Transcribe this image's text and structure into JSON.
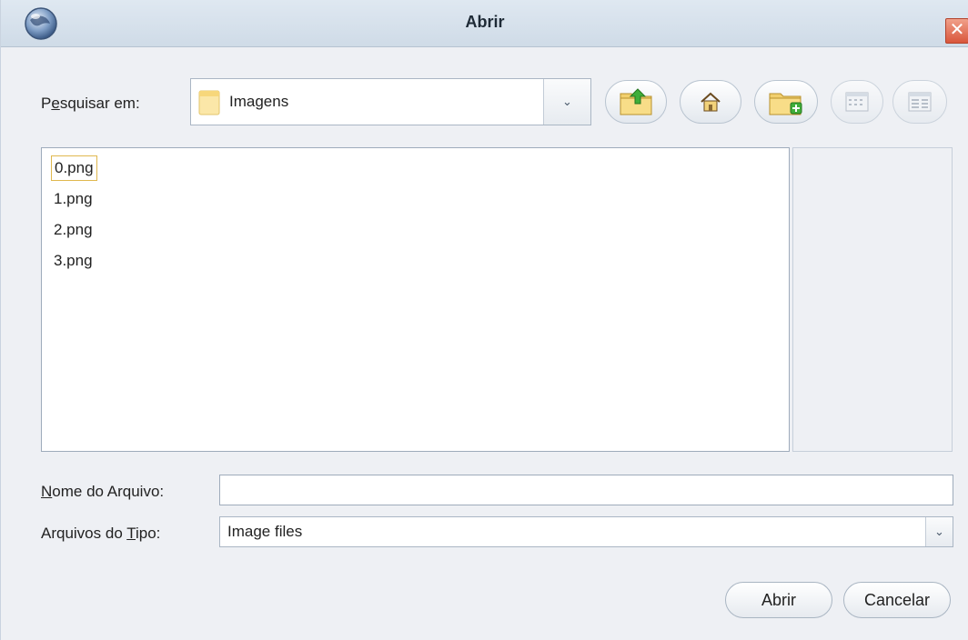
{
  "window": {
    "title": "Abrir",
    "close_symbol": "✕",
    "app_icon": "globe-icon"
  },
  "look_in": {
    "label_prefix": "P",
    "label_underlined": "e",
    "label_rest": "squisar em:",
    "value": "Imagens",
    "folder_icon": "folder-icon",
    "arrow": "⌄"
  },
  "toolbar": {
    "buttons": [
      {
        "name": "up-folder-button",
        "icon": "folder-up-icon"
      },
      {
        "name": "home-button",
        "icon": "home-icon"
      },
      {
        "name": "new-folder-button",
        "icon": "new-folder-icon"
      },
      {
        "name": "list-view-button",
        "icon": "list-view-icon"
      },
      {
        "name": "details-view-button",
        "icon": "details-view-icon"
      }
    ]
  },
  "files": [
    "0.png",
    "1.png",
    "2.png",
    "3.png"
  ],
  "selected_file_index": 0,
  "file_name": {
    "label_underlined": "N",
    "label_rest": "ome do Arquivo:",
    "value": ""
  },
  "file_type": {
    "label_prefix": "Arquivos do ",
    "label_underlined": "T",
    "label_rest": "ipo:",
    "value": "Image files",
    "arrow": "⌄"
  },
  "actions": {
    "open_label": "Abrir",
    "cancel_label": "Cancelar"
  }
}
